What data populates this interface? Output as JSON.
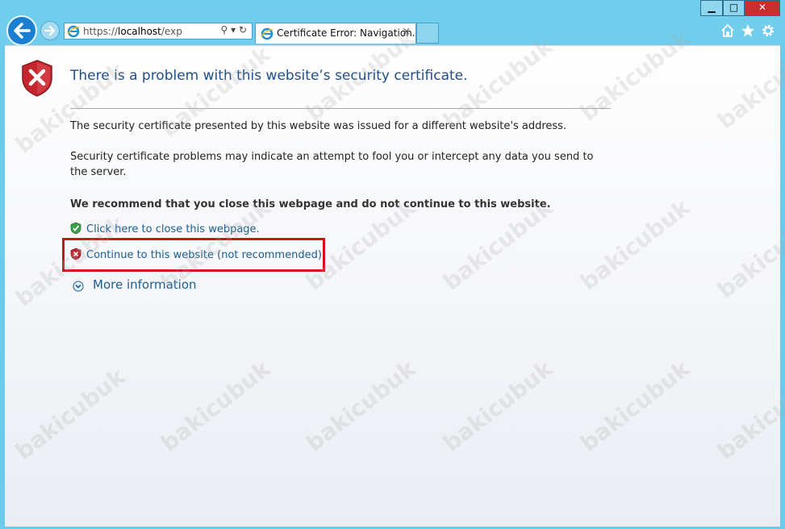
{
  "browser": {
    "address": {
      "scheme": "https://",
      "host": "localhost",
      "path": "/exp"
    },
    "tab": {
      "title": "Certificate Error: Navigation...",
      "close_glyph": "×"
    },
    "window_controls": {
      "minimize": "▁",
      "maximize": "□",
      "close": "✕"
    },
    "toolbar_icons": [
      "home-icon",
      "star-icon",
      "gear-icon"
    ]
  },
  "page": {
    "heading": "There is a problem with this website’s security certificate.",
    "paragraph1": "The security certificate presented by this website was issued for a different website's address.",
    "paragraph2": "Security certificate problems may indicate an attempt to fool you or intercept any data you send to the server.",
    "recommendation": "We recommend that you close this webpage and do not continue to this website.",
    "close_link": "Click here to close this webpage.",
    "continue_link": "Continue to this website (not recommended).",
    "more_info": "More information"
  },
  "watermark": "bakicubuk",
  "colors": {
    "frame": "#6ccaea",
    "heading": "#1f4f8a",
    "link": "#1a5f8f",
    "highlight": "#d0121a"
  }
}
